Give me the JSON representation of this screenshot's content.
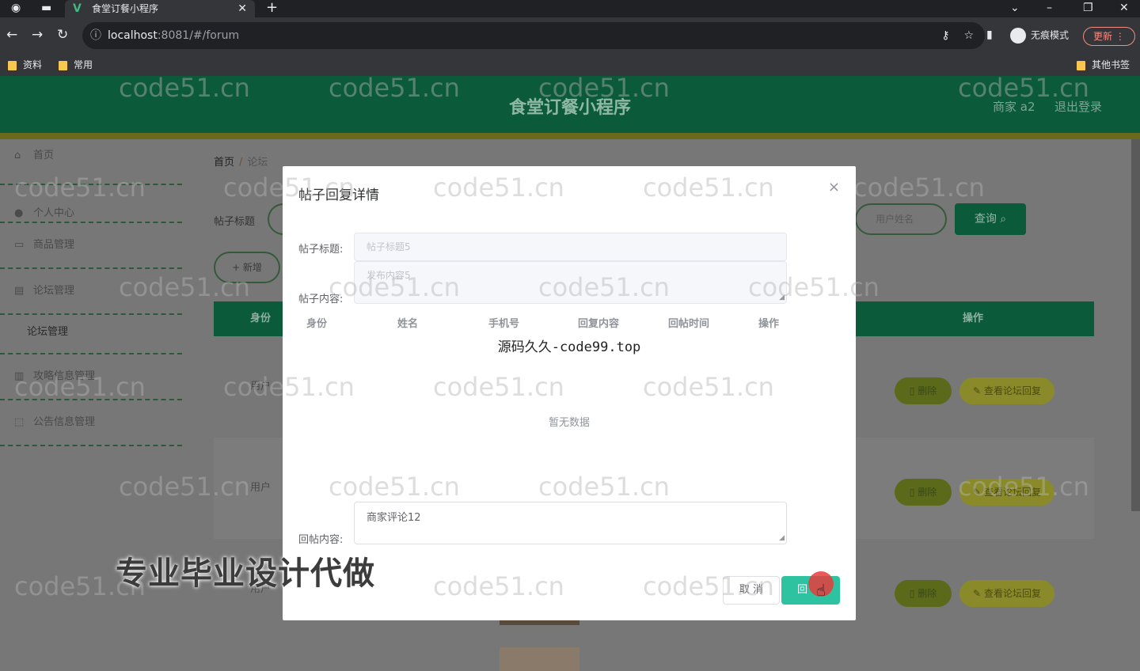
{
  "browser": {
    "tab_title": "食堂订餐小程序",
    "tab_close": "✕",
    "new_tab": "+",
    "url_host": "localhost",
    "url_rest": ":8081/#/forum",
    "incognito_label": "无痕模式",
    "update_label": "更新",
    "bookmarks": [
      "资料",
      "常用"
    ],
    "other_bookmarks": "其他书签"
  },
  "app": {
    "title": "食堂订餐小程序",
    "user_label": "商家 a2",
    "logout_label": "退出登录"
  },
  "sidebar": {
    "items": [
      {
        "label": "首页",
        "icon": "home-icon"
      },
      {
        "label": "个人中心",
        "icon": "user-icon"
      },
      {
        "label": "商品管理",
        "icon": "goods-icon"
      },
      {
        "label": "论坛管理",
        "icon": "forum-icon"
      },
      {
        "label": "论坛管理",
        "icon": ""
      },
      {
        "label": "攻略信息管理",
        "icon": "guide-icon"
      },
      {
        "label": "公告信息管理",
        "icon": "notice-icon"
      }
    ]
  },
  "breadcrumb": {
    "home": "首页",
    "separator": "/",
    "current": "论坛"
  },
  "search": {
    "title_label": "帖子标题",
    "user_placeholder": "用户姓名",
    "query_label": "查询",
    "add_label": "+ 新增"
  },
  "table": {
    "headers": {
      "identity": "身份",
      "actions": "操作"
    },
    "rows": [
      {
        "identity": "用户",
        "delete": "删除",
        "view_replies": "查看论坛回复"
      },
      {
        "identity": "用户",
        "delete": "删除",
        "view_replies": "查看论坛回复"
      },
      {
        "identity": "用户",
        "delete": "删除",
        "view_replies": "查看论坛回复"
      }
    ]
  },
  "dialog": {
    "title": "帖子回复详情",
    "close": "×",
    "post_title_label": "帖子标题:",
    "post_title_value": "帖子标题5",
    "post_content_label": "帖子内容:",
    "post_content_value": "发布内容5",
    "reply_table_headers": [
      "身份",
      "姓名",
      "手机号",
      "回复内容",
      "回帖时间",
      "操作"
    ],
    "promo_text": "源码久久-code99.top",
    "empty_text": "暂无数据",
    "reply_label": "回帖内容:",
    "reply_value": "商家评论12",
    "cancel_label": "取 消",
    "reply_button": "回"
  },
  "overlay_caption": "专业毕业设计代做",
  "watermark": "code51.cn",
  "colors": {
    "header": "#0b5a3a",
    "accent": "#2ec3a0",
    "delete": "#5a6a1a",
    "view": "#8a8a2a"
  }
}
